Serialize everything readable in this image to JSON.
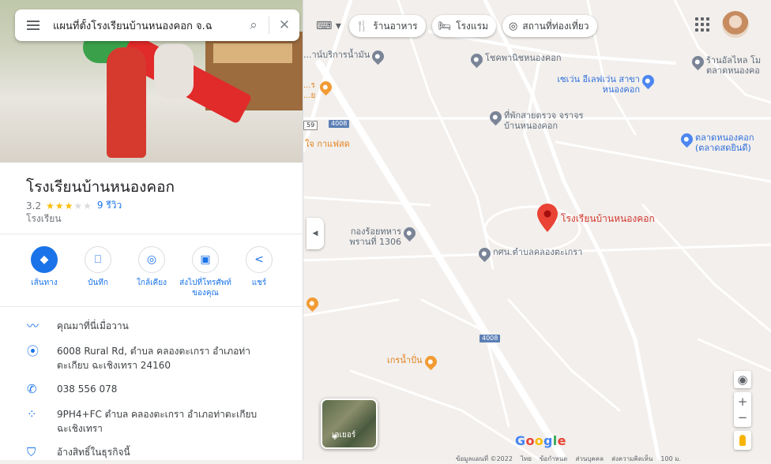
{
  "search": {
    "value": "แผนที่ตั้งโรงเรียนบ้านหนองคอก จ.ฉ",
    "search_icon": "search-icon",
    "close_icon": "close-icon"
  },
  "chips": [
    {
      "label": "ร้านอาหาร",
      "icon": "restaurant-icon"
    },
    {
      "label": "โรงแรม",
      "icon": "hotel-icon"
    },
    {
      "label": "สถานที่ท่องเที่ยว",
      "icon": "attraction-icon"
    }
  ],
  "place": {
    "title": "โรงเรียนบ้านหนองคอก",
    "rating": "3.2",
    "rating_value": 3.2,
    "reviews": "9 รีวิว",
    "category": "โรงเรียน"
  },
  "actions": [
    {
      "label": "เส้นทาง",
      "icon": "directions-icon"
    },
    {
      "label": "บันทึก",
      "icon": "bookmark-icon"
    },
    {
      "label": "ใกล้เคียง",
      "icon": "nearby-icon"
    },
    {
      "label": "ส่งไปที่โทรศัพท์ของคุณ",
      "icon": "send-to-phone-icon"
    },
    {
      "label": "แชร์",
      "icon": "share-icon"
    }
  ],
  "info": [
    {
      "text": "คุณมาที่นี่เมื่อวาน",
      "icon": "trend-icon"
    },
    {
      "text": "6008 Rural Rd, ตำบล คลองตะเกรา อำเภอท่าตะเกียบ ฉะเชิงเทรา 24160",
      "icon": "location-pin-icon"
    },
    {
      "text": "038 556 078",
      "icon": "phone-icon"
    },
    {
      "text": "9PH4+FC ตำบล คลองตะเกรา อำเภอท่าตะเกียบ ฉะเชิงเทรา",
      "icon": "plus-code-icon"
    },
    {
      "text": "อ้างสิทธิ์ในธุรกิจนี้",
      "icon": "shield-icon"
    }
  ],
  "map": {
    "labels": {
      "service": "...าน์บริการน้ำมัน",
      "chokpanich": "โชคพานิชหนองคอก",
      "seven": "เซเว่น อีเลฟเว่น สาขาหนองคอก",
      "rest_stop": "ที่พักสายตรวจ จราจรบ้านหนองคอก",
      "market": "ตลาดหนองคอก (ตลาดสดยินดี)",
      "shell": "ร้านอัลไหล โม ตลาดหนองคอ",
      "cafe": "ใจ กาแฟสด",
      "company": "กองร้อยทหาร พรานที่ 1306",
      "community": "กศน.ตำบลคลองตะเกรา",
      "kettle": "เกรน้ำปั่น",
      "main": "โรงเรียนบ้านหนองคอก",
      "road_partial": "...ร ...ย",
      "road1": "4008",
      "road2": "4008",
      "road3": "59"
    },
    "layers_label": "เลเยอร์",
    "google": [
      "G",
      "o",
      "o",
      "g",
      "l",
      "e"
    ],
    "google_colors": [
      "#4285f4",
      "#ea4335",
      "#fbbc05",
      "#4285f4",
      "#34a853",
      "#ea4335"
    ],
    "footer": [
      "ข้อมูลแผนที่ ©2022",
      "ไทย",
      "ข้อกำหนด",
      "ส่วนบุคคล",
      "ส่งความคิดเห็น",
      "100 ม."
    ]
  }
}
